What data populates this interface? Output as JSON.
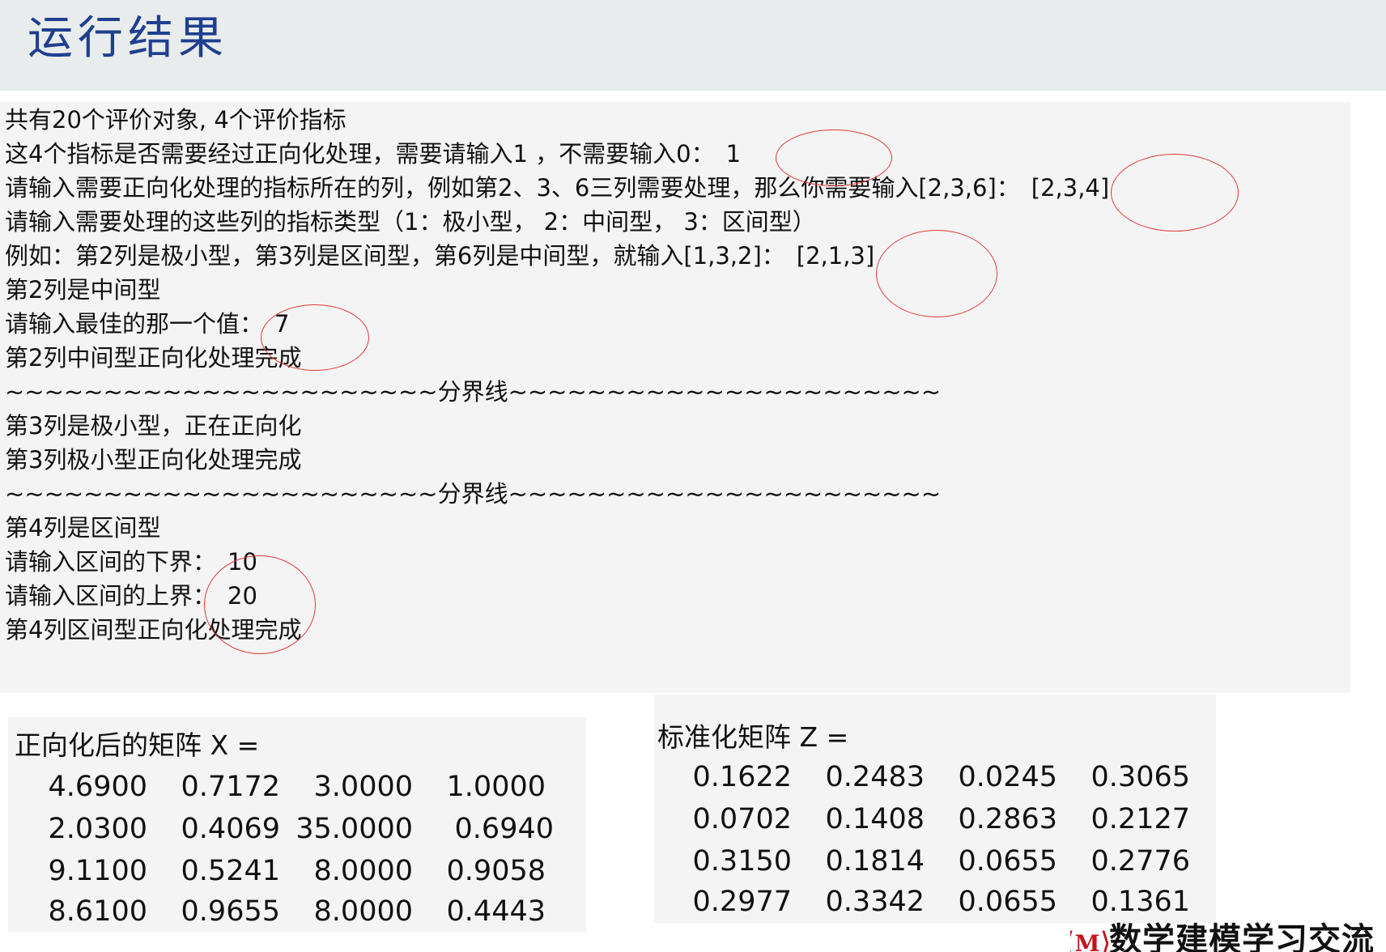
{
  "header": {
    "title": "运行结果"
  },
  "console": {
    "lines": [
      {
        "text": "共有20个评价对象, 4个评价指标",
        "answer": ""
      },
      {
        "text": "这4个指标是否需要经过正向化处理，需要请输入1 ，不需要输入0：",
        "answer": "1"
      },
      {
        "text": "请输入需要正向化处理的指标所在的列，例如第2、3、6三列需要处理，那么你需要输入[2,3,6]：",
        "answer": "[2,3,4]"
      },
      {
        "text": "请输入需要处理的这些列的指标类型（1：极小型， 2：中间型， 3：区间型）",
        "answer": ""
      },
      {
        "text": "例如：第2列是极小型，第3列是区间型，第6列是中间型，就输入[1,3,2]：",
        "answer": "[2,1,3]"
      },
      {
        "text": "第2列是中间型",
        "answer": ""
      },
      {
        "text": "请输入最佳的那一个值：",
        "answer": "7"
      },
      {
        "text": "第2列中间型正向化处理完成",
        "answer": ""
      },
      {
        "text": "~~~~~~~~~~~~~~~~~~~~~~分界线~~~~~~~~~~~~~~~~~~~~~~",
        "answer": ""
      },
      {
        "text": "第3列是极小型，正在正向化",
        "answer": ""
      },
      {
        "text": "第3列极小型正向化处理完成",
        "answer": ""
      },
      {
        "text": "~~~~~~~~~~~~~~~~~~~~~~分界线~~~~~~~~~~~~~~~~~~~~~~",
        "answer": ""
      },
      {
        "text": "第4列是区间型",
        "answer": ""
      },
      {
        "text": "请输入区间的下界：",
        "answer": "10"
      },
      {
        "text": "请输入区间的上界：",
        "answer": "20"
      },
      {
        "text": "第4列区间型正向化处理完成",
        "answer": ""
      }
    ]
  },
  "matrix_x": {
    "title": "正向化后的矩阵 X =",
    "rows": [
      [
        "4.6900",
        "0.7172",
        "3.0000",
        "1.0000"
      ],
      [
        "2.0300",
        "0.4069",
        "35.0000",
        "0.6940"
      ],
      [
        "9.1100",
        "0.5241",
        "8.0000",
        "0.9058"
      ],
      [
        "8.6100",
        "0.9655",
        "8.0000",
        "0.4443"
      ]
    ]
  },
  "matrix_z": {
    "title": "标准化矩阵 Z =",
    "rows": [
      [
        "0.1622",
        "0.2483",
        "0.0245",
        "0.3065"
      ],
      [
        "0.0702",
        "0.1408",
        "0.2863",
        "0.2127"
      ],
      [
        "0.3150",
        "0.1814",
        "0.0655",
        "0.2776"
      ],
      [
        "0.2977",
        "0.3342",
        "0.0655",
        "0.1361"
      ]
    ]
  },
  "brand": {
    "logo_letter": "M",
    "name": "数学建模学习交流"
  },
  "colors": {
    "title": "#1f3f8f",
    "annotation": "#e23a3a",
    "panel": "#f4f4f4",
    "header_bg": "#e8ecec"
  }
}
